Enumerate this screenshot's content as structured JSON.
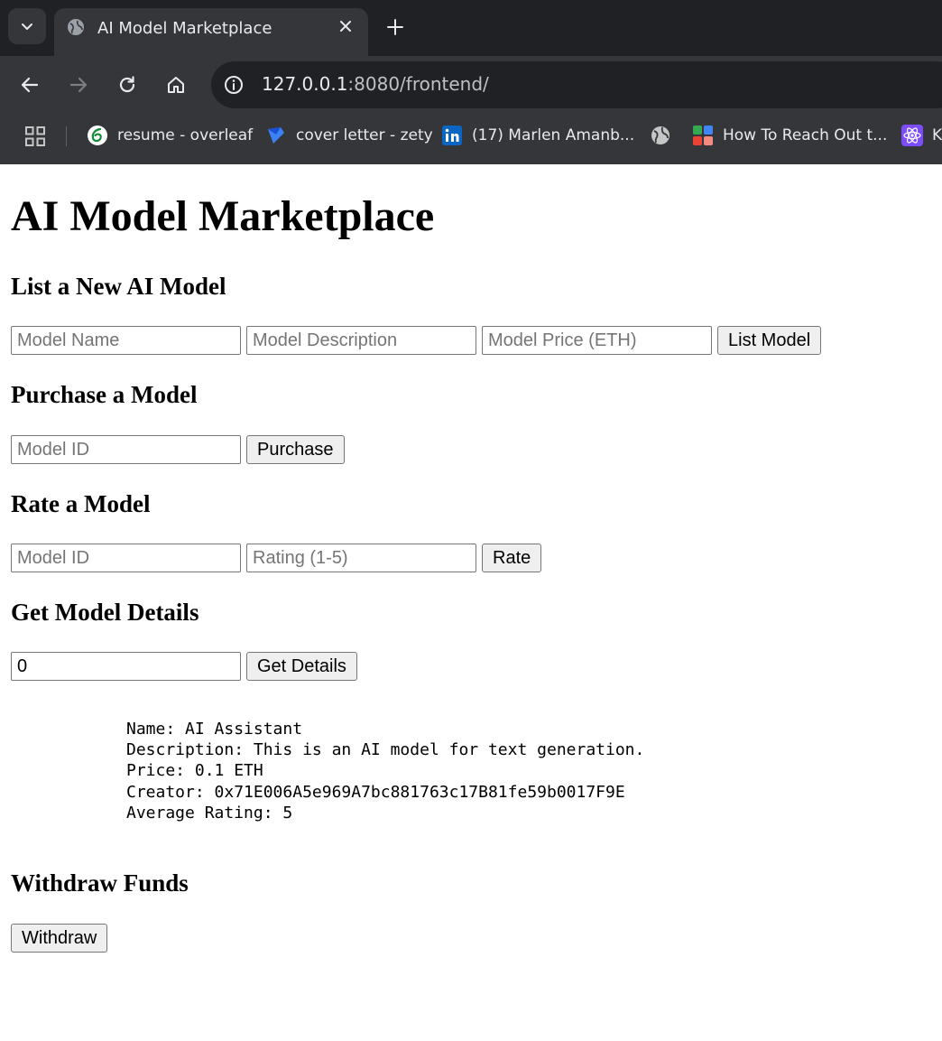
{
  "browser": {
    "tab_title": "AI Model Marketplace",
    "url_host": "127.0.0.1",
    "url_rest": ":8080/frontend/",
    "bookmarks": [
      {
        "label": "resume - overleaf",
        "icon": "overleaf-icon"
      },
      {
        "label": "cover letter - zety",
        "icon": "zety-icon"
      },
      {
        "label": "(17) Marlen Amanb...",
        "icon": "linkedin-icon"
      },
      {
        "label": "",
        "icon": "globe-icon"
      },
      {
        "label": "How To Reach Out t...",
        "icon": "puzzle-icon"
      },
      {
        "label": "K",
        "icon": "react-icon"
      }
    ]
  },
  "page": {
    "title": "AI Model Marketplace",
    "list": {
      "heading": "List a New AI Model",
      "name_placeholder": "Model Name",
      "description_placeholder": "Model Description",
      "price_placeholder": "Model Price (ETH)",
      "button": "List Model"
    },
    "purchase": {
      "heading": "Purchase a Model",
      "id_placeholder": "Model ID",
      "button": "Purchase"
    },
    "rate": {
      "heading": "Rate a Model",
      "id_placeholder": "Model ID",
      "rating_placeholder": "Rating (1-5)",
      "button": "Rate"
    },
    "details": {
      "heading": "Get Model Details",
      "id_value": "0",
      "button": "Get Details",
      "output": "Name: AI Assistant\nDescription: This is an AI model for text generation.\nPrice: 0.1 ETH\nCreator: 0x71E006A5e969A7bc881763c17B81fe59b0017F9E\nAverage Rating: 5"
    },
    "withdraw": {
      "heading": "Withdraw Funds",
      "button": "Withdraw"
    }
  }
}
